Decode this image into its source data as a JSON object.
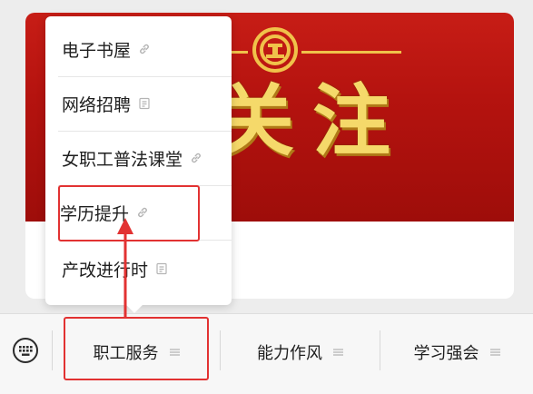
{
  "banner": {
    "char_1": "关",
    "char_2": "注"
  },
  "popup_menu": {
    "items": [
      {
        "label": "电子书屋",
        "icon": "link-icon"
      },
      {
        "label": "网络招聘",
        "icon": "page-icon"
      },
      {
        "label": "女职工普法课堂",
        "icon": "link-icon"
      },
      {
        "label": "学历提升",
        "icon": "link-icon"
      },
      {
        "label": "产改进行时",
        "icon": "page-icon"
      }
    ]
  },
  "bottom_menu": {
    "items": [
      {
        "label": "职工服务",
        "icon": "menu-lines-icon"
      },
      {
        "label": "能力作风",
        "icon": "menu-lines-icon"
      },
      {
        "label": "学习强会",
        "icon": "menu-lines-icon"
      }
    ]
  },
  "colors": {
    "highlight": "#e23232",
    "banner_red": "#c71d16",
    "banner_gold": "#f5d96a"
  }
}
